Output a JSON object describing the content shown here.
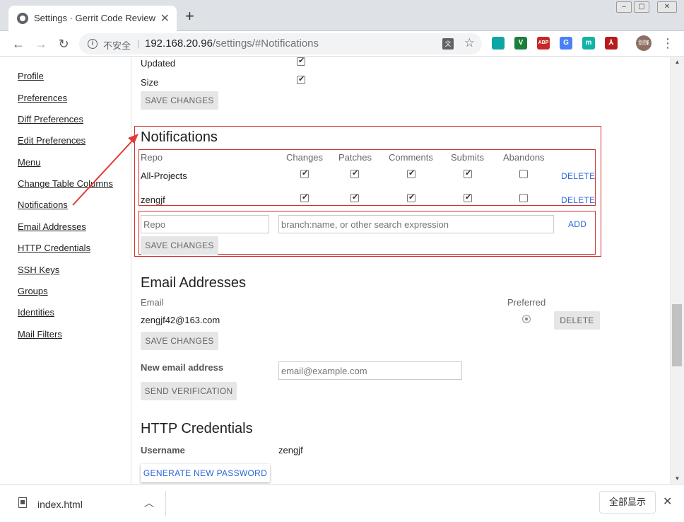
{
  "browser": {
    "tab_title": "Settings · Gerrit Code Review",
    "tab_close": "✕",
    "new_tab": "+",
    "insecure_label": "不安全",
    "url_host": "192.168.20.96",
    "url_path": "/settings/#Notifications",
    "extensions": [
      {
        "name": "stylus-icon",
        "label": "",
        "color": "#0ea5a5"
      },
      {
        "name": "v-extension-icon",
        "label": "V",
        "color": "#1b7f3b"
      },
      {
        "name": "adblock-plus-icon",
        "label": "ABP",
        "color": "#c62828"
      },
      {
        "name": "google-translate-icon",
        "label": "G",
        "color": "#4a80f5"
      },
      {
        "name": "m-extension-icon",
        "label": "m",
        "color": "#12b3a5"
      },
      {
        "name": "pdf-extension-icon",
        "label": "⅄",
        "color": "#b71c1c"
      }
    ],
    "avatar_text": "剑锋"
  },
  "sidebar": {
    "items": [
      {
        "label": "Profile"
      },
      {
        "label": "Preferences"
      },
      {
        "label": "Diff Preferences"
      },
      {
        "label": "Edit Preferences"
      },
      {
        "label": "Menu"
      },
      {
        "label": "Change Table Columns"
      },
      {
        "label": "Notifications"
      },
      {
        "label": "Email Addresses"
      },
      {
        "label": "HTTP Credentials"
      },
      {
        "label": "SSH Keys"
      },
      {
        "label": "Groups"
      },
      {
        "label": "Identities"
      },
      {
        "label": "Mail Filters"
      }
    ]
  },
  "columns_section": {
    "rows": [
      {
        "label": "Updated",
        "checked": true
      },
      {
        "label": "Size",
        "checked": true
      }
    ],
    "save_label": "SAVE CHANGES"
  },
  "notifications": {
    "title": "Notifications",
    "headers": [
      "Repo",
      "Changes",
      "Patches",
      "Comments",
      "Submits",
      "Abandons"
    ],
    "rows": [
      {
        "repo": "All-Projects",
        "changes": true,
        "patches": true,
        "comments": true,
        "submits": true,
        "abandons": false,
        "delete_label": "DELETE"
      },
      {
        "repo": "zengjf",
        "changes": true,
        "patches": true,
        "comments": true,
        "submits": true,
        "abandons": false,
        "delete_label": "DELETE"
      }
    ],
    "repo_placeholder": "Repo",
    "filter_placeholder": "branch:name, or other search expression",
    "add_label": "ADD",
    "save_label": "SAVE CHANGES"
  },
  "email": {
    "title": "Email Addresses",
    "email_header": "Email",
    "preferred_header": "Preferred",
    "address": "zengjf42@163.com",
    "delete_label": "DELETE",
    "save_label": "SAVE CHANGES",
    "new_label": "New email address",
    "new_placeholder": "email@example.com",
    "send_label": "SEND VERIFICATION"
  },
  "http": {
    "title": "HTTP Credentials",
    "username_label": "Username",
    "username": "zengjf",
    "generate_label": "GENERATE NEW PASSWORD"
  },
  "download": {
    "filename": "index.html",
    "show_all": "全部显示"
  },
  "colors": {
    "accent_link": "#2a66d9",
    "annotation_red": "#d32f2f"
  }
}
